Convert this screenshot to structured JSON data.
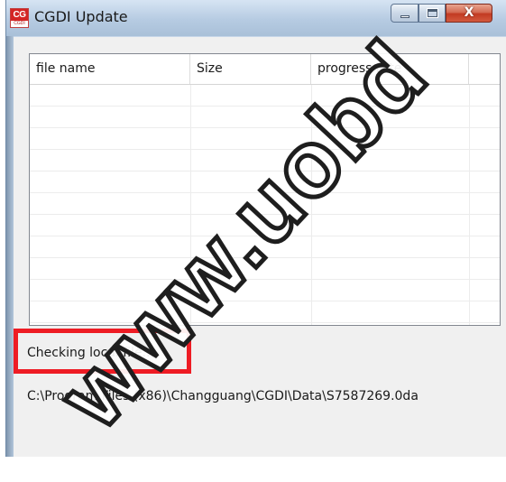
{
  "window": {
    "title": "CGDI Update",
    "icon_text_top": "CG",
    "icon_text_bottom": "CGDI",
    "close_glyph": "X"
  },
  "file_list": {
    "columns": [
      {
        "label": "file name"
      },
      {
        "label": "Size"
      },
      {
        "label": "progress rate"
      },
      {
        "label": ""
      }
    ],
    "rows": []
  },
  "status": {
    "message": "Checking local file...",
    "highlight_color": "#ee1c24"
  },
  "current_file": {
    "path": "C:\\Program Files (x86)\\Changguang\\CGDI\\Data\\S7587269.0da"
  },
  "watermark": {
    "text": "www.uobd"
  },
  "colors": {
    "close_button": "#c23a22",
    "titlebar": "#b6cbe2",
    "client_bg": "#f0f0f0"
  }
}
